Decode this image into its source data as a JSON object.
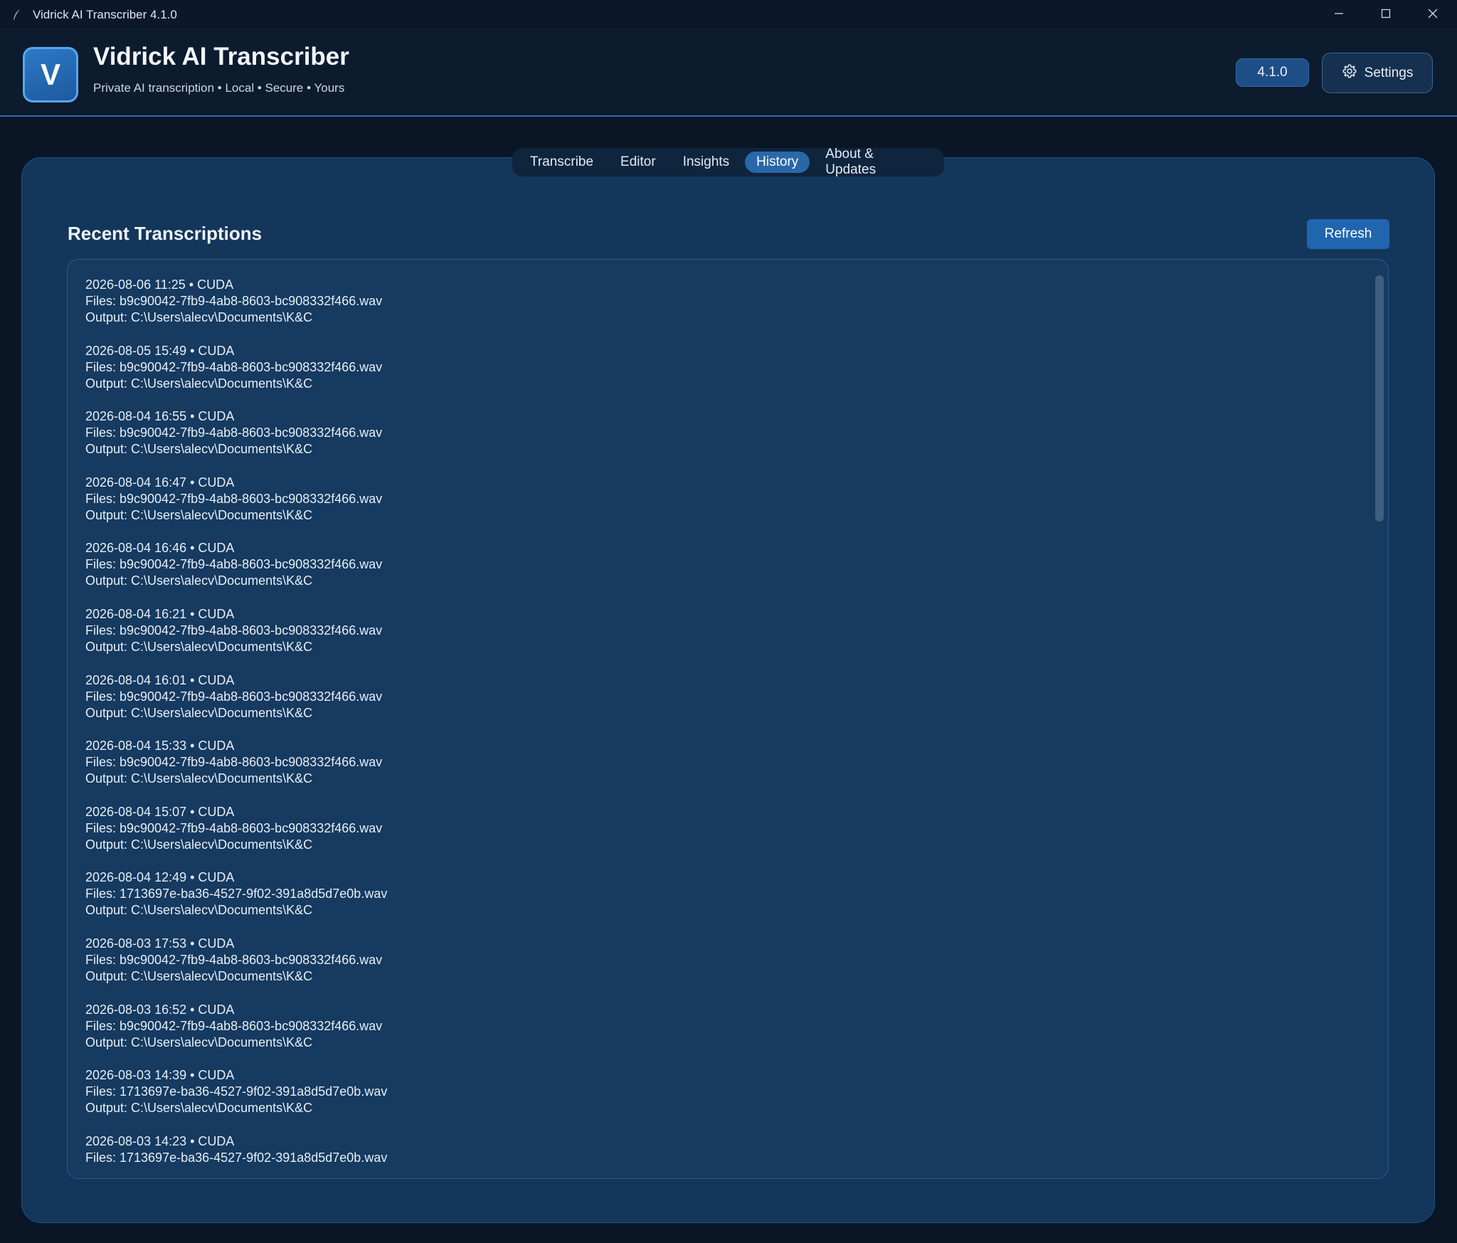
{
  "window": {
    "title": "Vidrick AI Transcriber 4.1.0"
  },
  "header": {
    "logo_letter": "V",
    "app_name": "Vidrick AI Transcriber",
    "tagline": "Private AI transcription • Local • Secure • Yours",
    "version": "4.1.0",
    "settings_label": "Settings"
  },
  "tabs": [
    {
      "label": "Transcribe",
      "active": false
    },
    {
      "label": "Editor",
      "active": false
    },
    {
      "label": "Insights",
      "active": false
    },
    {
      "label": "History",
      "active": true
    },
    {
      "label": "About & Updates",
      "active": false
    }
  ],
  "history": {
    "title": "Recent Transcriptions",
    "refresh_label": "Refresh",
    "entries": [
      {
        "meta": "2026-08-06 11:25 • CUDA",
        "files": "Files: b9c90042-7fb9-4ab8-8603-bc908332f466.wav",
        "output": "Output: C:\\Users\\alecv\\Documents\\K&C"
      },
      {
        "meta": "2026-08-05 15:49 • CUDA",
        "files": "Files: b9c90042-7fb9-4ab8-8603-bc908332f466.wav",
        "output": "Output: C:\\Users\\alecv\\Documents\\K&C"
      },
      {
        "meta": "2026-08-04 16:55 • CUDA",
        "files": "Files: b9c90042-7fb9-4ab8-8603-bc908332f466.wav",
        "output": "Output: C:\\Users\\alecv\\Documents\\K&C"
      },
      {
        "meta": "2026-08-04 16:47 • CUDA",
        "files": "Files: b9c90042-7fb9-4ab8-8603-bc908332f466.wav",
        "output": "Output: C:\\Users\\alecv\\Documents\\K&C"
      },
      {
        "meta": "2026-08-04 16:46 • CUDA",
        "files": "Files: b9c90042-7fb9-4ab8-8603-bc908332f466.wav",
        "output": "Output: C:\\Users\\alecv\\Documents\\K&C"
      },
      {
        "meta": "2026-08-04 16:21 • CUDA",
        "files": "Files: b9c90042-7fb9-4ab8-8603-bc908332f466.wav",
        "output": "Output: C:\\Users\\alecv\\Documents\\K&C"
      },
      {
        "meta": "2026-08-04 16:01 • CUDA",
        "files": "Files: b9c90042-7fb9-4ab8-8603-bc908332f466.wav",
        "output": "Output: C:\\Users\\alecv\\Documents\\K&C"
      },
      {
        "meta": "2026-08-04 15:33 • CUDA",
        "files": "Files: b9c90042-7fb9-4ab8-8603-bc908332f466.wav",
        "output": "Output: C:\\Users\\alecv\\Documents\\K&C"
      },
      {
        "meta": "2026-08-04 15:07 • CUDA",
        "files": "Files: b9c90042-7fb9-4ab8-8603-bc908332f466.wav",
        "output": "Output: C:\\Users\\alecv\\Documents\\K&C"
      },
      {
        "meta": "2026-08-04 12:49 • CUDA",
        "files": "Files: 1713697e-ba36-4527-9f02-391a8d5d7e0b.wav",
        "output": "Output: C:\\Users\\alecv\\Documents\\K&C"
      },
      {
        "meta": "2026-08-03 17:53 • CUDA",
        "files": "Files: b9c90042-7fb9-4ab8-8603-bc908332f466.wav",
        "output": "Output: C:\\Users\\alecv\\Documents\\K&C"
      },
      {
        "meta": "2026-08-03 16:52 • CUDA",
        "files": "Files: b9c90042-7fb9-4ab8-8603-bc908332f466.wav",
        "output": "Output: C:\\Users\\alecv\\Documents\\K&C"
      },
      {
        "meta": "2026-08-03 14:39 • CUDA",
        "files": "Files: 1713697e-ba36-4527-9f02-391a8d5d7e0b.wav",
        "output": "Output: C:\\Users\\alecv\\Documents\\K&C"
      },
      {
        "meta": "2026-08-03 14:23 • CUDA",
        "files": "Files: 1713697e-ba36-4527-9f02-391a8d5d7e0b.wav",
        "output": ""
      }
    ]
  }
}
